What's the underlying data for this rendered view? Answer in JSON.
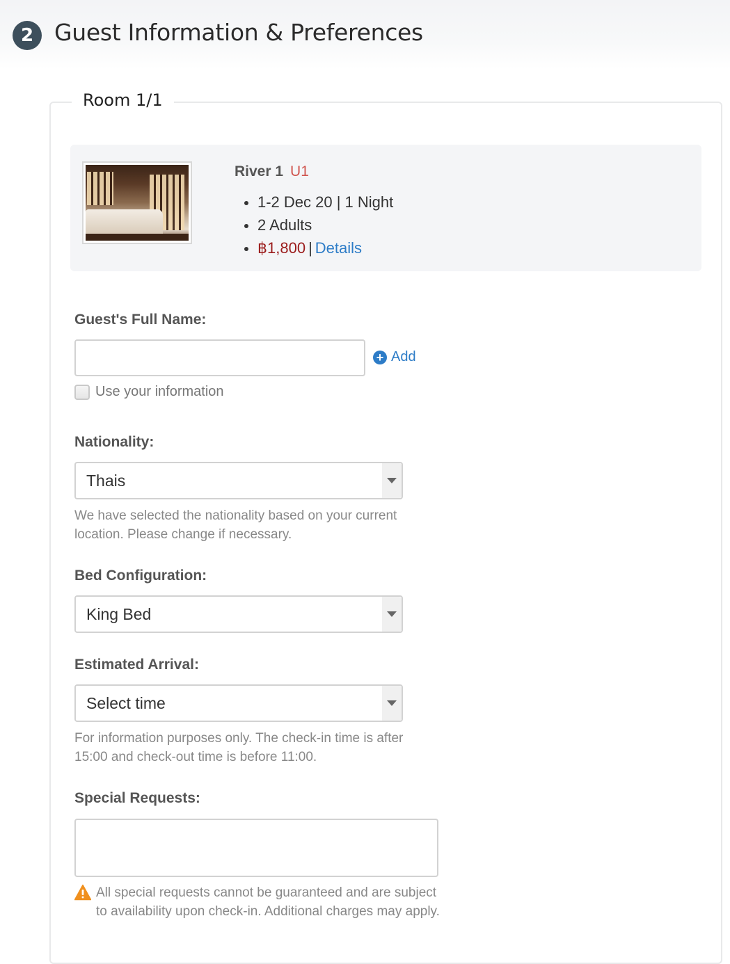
{
  "header": {
    "step_number": "2",
    "title": "Guest Information & Preferences"
  },
  "room": {
    "legend": "Room 1/1",
    "photo_alt": "Bedroom with wooden windows and double bed",
    "name": "River 1",
    "code": "U1",
    "dates": "1-2 Dec 20 | 1 Night",
    "guests": "2 Adults",
    "price": "฿1,800",
    "price_separator": "|",
    "details_link": "Details",
    "price_color": "#9b1c1c",
    "code_color": "#d0554f",
    "link_color": "#2d7cc7"
  },
  "guest_name": {
    "label": "Guest's Full Name:",
    "value": "",
    "placeholder": "",
    "add_label": "Add",
    "use_info_label": "Use your information",
    "use_info_checked": false
  },
  "nationality": {
    "label": "Nationality:",
    "selected": "Thais",
    "help": "We have selected the nationality based on your current location. Please change if necessary."
  },
  "bed": {
    "label": "Bed Configuration:",
    "selected": "King Bed"
  },
  "arrival": {
    "label": "Estimated Arrival:",
    "selected": "Select time",
    "help": "For information purposes only. The check-in time is after 15:00 and check-out time is before 11:00."
  },
  "special_requests": {
    "label": "Special Requests:",
    "value": "",
    "warning": "All special requests cannot be guaranteed and are subject to availability upon check-in. Additional charges may apply.",
    "warning_color": "#f0901e"
  }
}
